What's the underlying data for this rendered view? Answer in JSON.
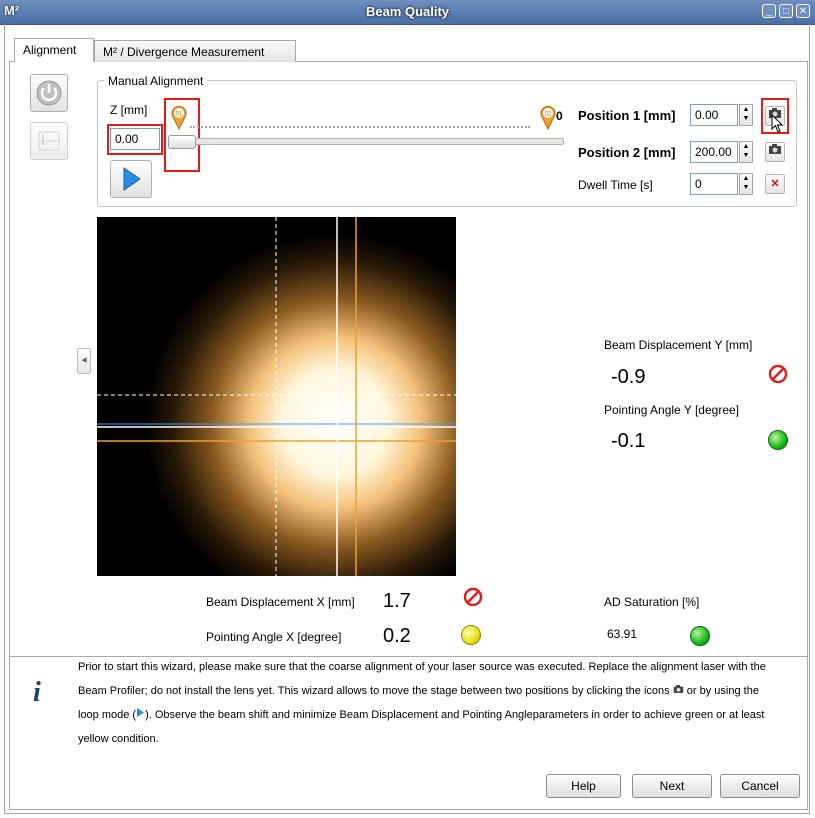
{
  "window": {
    "app_icon": "M²",
    "title": "Beam Quality",
    "controls": [
      "minimize-icon",
      "maximize-icon",
      "close-icon"
    ]
  },
  "tabs": [
    {
      "label": "Alignment",
      "active": true
    },
    {
      "label": "M² / Divergence Measurement",
      "active": false
    }
  ],
  "manual_alignment": {
    "title": "Manual Alignment",
    "z_label": "Z [mm]",
    "z_value": "0.00",
    "marker1": "01",
    "marker2": "02",
    "position1_label": "Position 1 [mm]",
    "position1_value": "0.00",
    "position2_label": "Position 2 [mm]",
    "position2_value": "200.00",
    "dwell_label": "Dwell Time [s]",
    "dwell_value": "0"
  },
  "readouts": {
    "disp_y_label": "Beam Displacement Y [mm]",
    "disp_y_value": "-0.9",
    "angle_y_label": "Pointing Angle Y [degree]",
    "angle_y_value": "-0.1",
    "disp_x_label": "Beam Displacement X [mm]",
    "disp_x_value": "1.7",
    "angle_x_label": "Pointing Angle X [degree]",
    "angle_x_value": "0.2",
    "ad_sat_label": "AD Saturation [%]",
    "ad_sat_value": "63.91"
  },
  "status_colors": {
    "ok": "#19b619",
    "warn": "#e6e21a",
    "bad": "#e31b1b"
  },
  "info": {
    "icon": "info-icon",
    "text_1": "Prior to start this wizard, please make sure that the coarse alignment of your laser source was executed. Replace the alignment laser with the",
    "text_2a": "Beam Profiler; do not install the lens yet. This wizard allows to move the stage between two positions by clicking the  icons",
    "text_2b": "or by using the",
    "text_3a": "loop mode (",
    "text_3b": "). Observe the beam shift and minimize Beam Displacement and Pointing Angleparameters in order to achieve green or at least",
    "text_4": "yellow condition."
  },
  "buttons": {
    "help": "Help",
    "next": "Next",
    "cancel": "Cancel"
  }
}
